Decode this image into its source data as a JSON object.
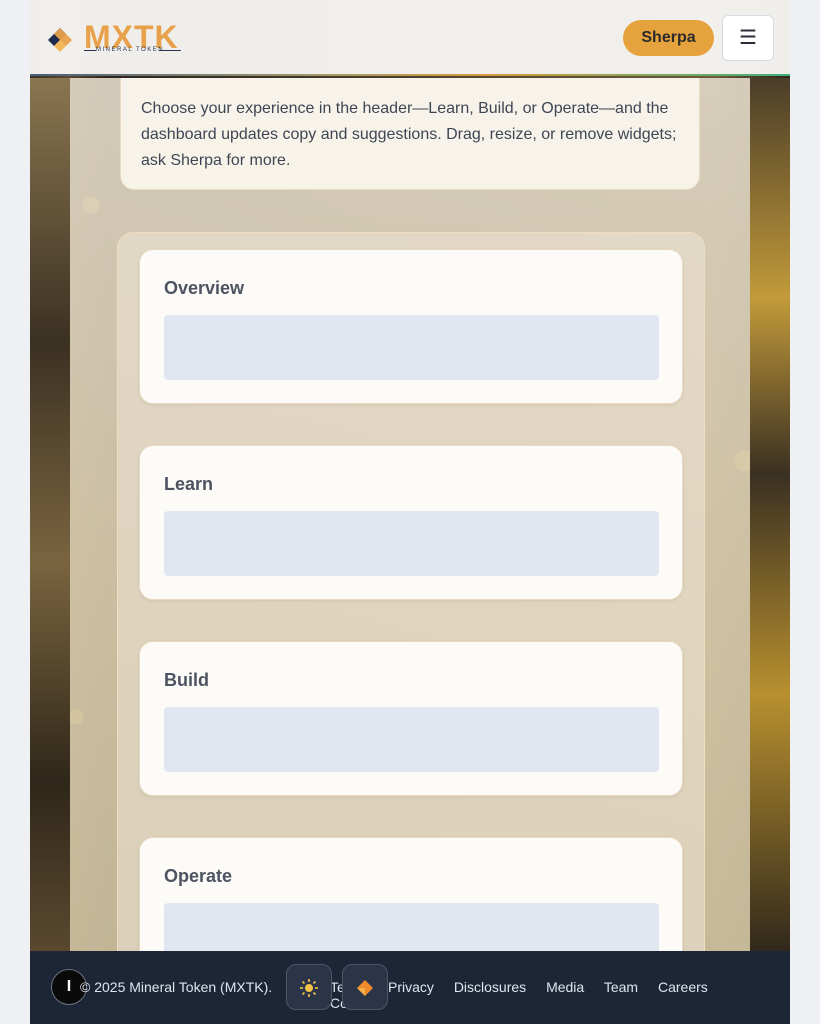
{
  "header": {
    "logo_text": "MXTK",
    "logo_subtitle": "MINERAL TOKEN",
    "sherpa_label": "Sherpa",
    "menu_icon": "hamburger-icon"
  },
  "intro": {
    "text": "Choose your experience in the header—Learn, Build, or Operate—and the dashboard updates copy and suggestions. Drag, resize, or remove widgets; ask Sherpa for more."
  },
  "widgets": [
    {
      "title": "Overview"
    },
    {
      "title": "Learn"
    },
    {
      "title": "Build"
    },
    {
      "title": "Operate"
    }
  ],
  "footer": {
    "copyright": "© 2025 Mineral Token (MXTK).",
    "links": [
      "Terms",
      "Privacy",
      "Disclosures",
      "Media",
      "Team",
      "Careers",
      "Contact"
    ],
    "info_icon": "info-icon",
    "theme_icon": "sun-icon",
    "mode_icon": "diamond-icon"
  },
  "colors": {
    "accent": "#e6a23c",
    "footer_bg": "#1c2636",
    "widget_placeholder": "#e1e7f0"
  }
}
